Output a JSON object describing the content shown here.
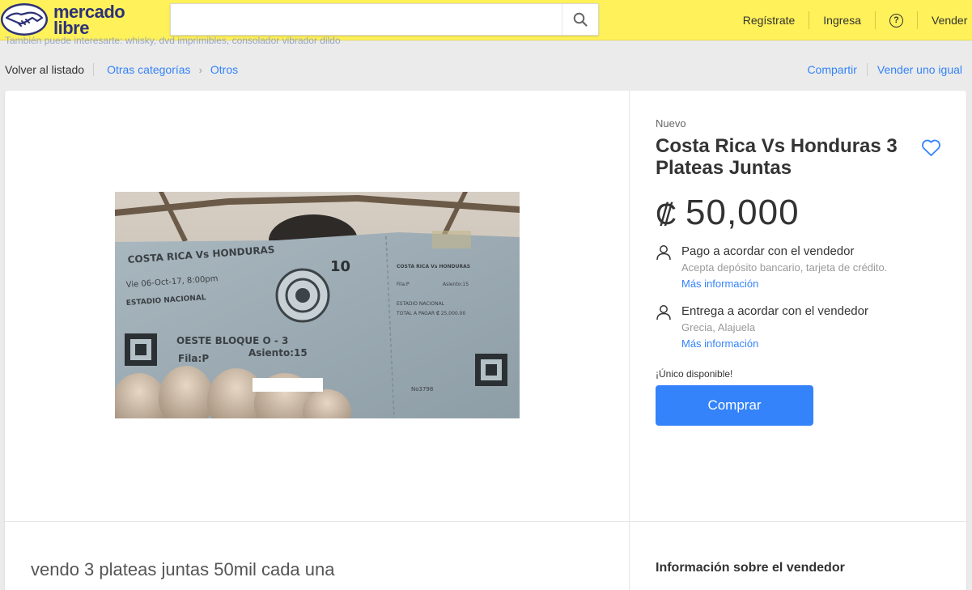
{
  "header": {
    "logo_line1": "mercado",
    "logo_line2": "libre",
    "search_placeholder": "",
    "nav": [
      "Regístrate",
      "Ingresa",
      "Vender"
    ],
    "help_symbol": "?"
  },
  "suggestions": "También puede interesarte: whisky, dvd imprimibles, consolador vibrador dildo",
  "breadcrumb": {
    "back": "Volver al listado",
    "items": [
      "Otras categorías",
      "Otros"
    ],
    "separator": "›"
  },
  "actions": {
    "share": "Compartir",
    "sell_similar": "Vender uno igual"
  },
  "product": {
    "condition": "Nuevo",
    "title": "Costa Rica Vs Honduras 3 Plateas Juntas",
    "currency": "₡",
    "price": "50,000",
    "payment": {
      "title": "Pago a acordar con el vendedor",
      "subtitle": "Acepta depósito bancario, tarjeta de crédito.",
      "link": "Más información"
    },
    "delivery": {
      "title": "Entrega a acordar con el vendedor",
      "subtitle": "Grecia, Alajuela",
      "link": "Más información"
    },
    "stock": "¡Único disponible!",
    "buy_label": "Comprar"
  },
  "ticket": {
    "match": "COSTA RICA Vs HONDURAS",
    "date": "Vie 06-Oct-17, 8:00pm",
    "venue": "ESTADIO NACIONAL",
    "block": "OESTE BLOQUE O - 3",
    "row": "Fila:P",
    "seat": "Asiento:15",
    "number": "10",
    "stub_match": "COSTA RICA Vs HONDURAS",
    "stub_row": "Fila:P",
    "stub_seat": "Asiento:15",
    "stub_venue": "ESTADIO NACIONAL",
    "stub_total": "TOTAL A PAGAR ₡ 25,000.00",
    "stub_no": "No3798"
  },
  "description": "vendo 3 plateas juntas 50mil cada una",
  "seller_heading": "Información sobre el vendedor",
  "colors": {
    "header_yellow": "#fff159",
    "accent_blue": "#3483fa",
    "logo_navy": "#2d3277"
  }
}
